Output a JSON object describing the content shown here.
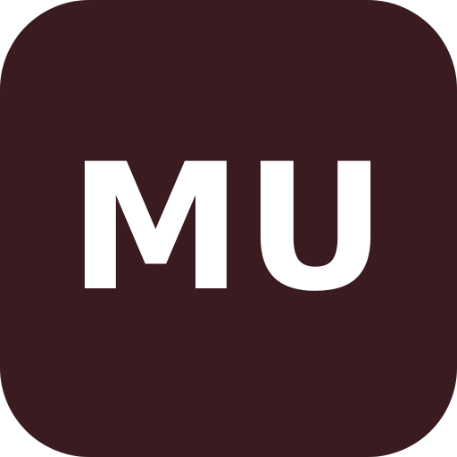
{
  "icon": {
    "text": "MU",
    "background_color": "#3a1b1f",
    "text_color": "#ffffff"
  }
}
